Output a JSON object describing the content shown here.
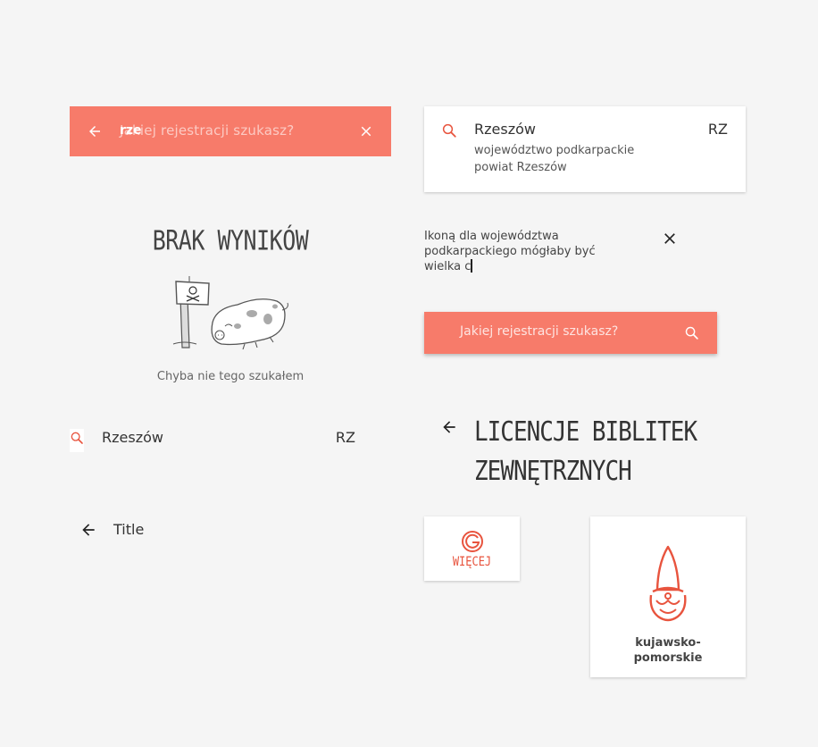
{
  "search_active": {
    "placeholder": "Jakiej rejestracji szukasz?",
    "typed_value": "rze",
    "back_icon": "arrow-back-icon",
    "clear_icon": "close-icon"
  },
  "result_card": {
    "city": "Rzeszów",
    "code": "RZ",
    "voivodeship": "województwo podkarpackie",
    "county": "powiat Rzeszów",
    "icon": "search-icon"
  },
  "no_results": {
    "title": "BRAK WYNIKÓW",
    "subtitle": "Chyba nie tego szukałem",
    "illustration": "skull-sign-and-pig-illustration"
  },
  "note": {
    "text": "Ikoną dla województwa podkarpackiego mógłaby być wielka c",
    "close_icon": "close-icon"
  },
  "search_collapsed": {
    "placeholder": "Jakiej rejestracji szukasz?",
    "icon": "search-icon"
  },
  "flat_result": {
    "city": "Rzeszów",
    "code": "RZ",
    "icon": "search-icon"
  },
  "licenses": {
    "title_line1": "LICENCJE BIBLITEK",
    "title_line2": "ZEWNĘTRZNYCH",
    "back_icon": "arrow-back-icon"
  },
  "title_bar": {
    "title": "Title",
    "back_icon": "arrow-back-icon"
  },
  "more_card": {
    "label": "WIĘCEJ",
    "icon": "g-logo-icon"
  },
  "voivodeship_card": {
    "name_line1": "kujawsko-",
    "name_line2": "pomorskie",
    "icon": "gnome-icon"
  },
  "colors": {
    "accent": "#f77b6a",
    "accent_dark": "#e8543e",
    "background": "#f5f5f5"
  }
}
